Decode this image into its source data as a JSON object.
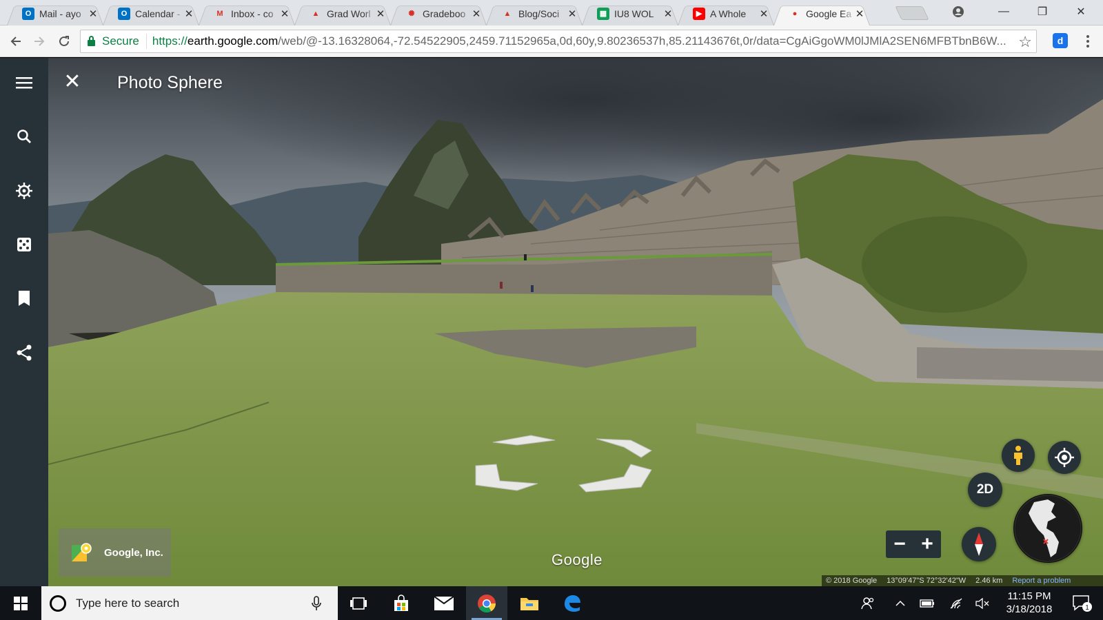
{
  "browser": {
    "tabs": [
      {
        "title": "Mail - ayo",
        "favicon_text": "O",
        "favicon_color": "#0072c6"
      },
      {
        "title": "Calendar -",
        "favicon_text": "O",
        "favicon_color": "#0072c6"
      },
      {
        "title": "Inbox - co",
        "favicon_text": "M",
        "favicon_color": "#ffffff"
      },
      {
        "title": "Grad Worl",
        "favicon_text": "▲",
        "favicon_color": "#ffffff"
      },
      {
        "title": "Gradeboo",
        "favicon_text": "✺",
        "favicon_color": "#ffffff"
      },
      {
        "title": "Blog/Soci",
        "favicon_text": "▲",
        "favicon_color": "#ffffff"
      },
      {
        "title": "IU8 WOL",
        "favicon_text": "▦",
        "favicon_color": "#0f9d58"
      },
      {
        "title": "A Whole",
        "favicon_text": "▶",
        "favicon_color": "#ff0000"
      },
      {
        "title": "Google Ea",
        "favicon_text": "●",
        "favicon_color": "#ffffff"
      }
    ],
    "active_tab": 8,
    "tab_close": "✕",
    "secure_label": "Secure",
    "url_scheme": "https://",
    "url_host": "earth.google.com",
    "url_rest": "/web/@-13.16328064,-72.54522905,2459.71152965a,0d,60y,9.80236537h,85.21143676t,0r/data=CgAiGgoWM0lJMlA2SEN6MFBTbnB6W...",
    "extension_label": "d"
  },
  "earth": {
    "photo_sphere_title": "Photo Sphere",
    "close_glyph": "✕",
    "attribution": "Google, Inc.",
    "watermark": "Google",
    "view_mode": "2D",
    "zoom_out": "−",
    "zoom_in": "+",
    "copyright": "© 2018 Google",
    "coordinates": "13°09'47\"S 72°32'42\"W",
    "scale": "2.46 km",
    "report": "Report a problem"
  },
  "taskbar": {
    "search_placeholder": "Type here to search",
    "time": "11:15 PM",
    "date": "3/18/2018",
    "notification_count": "1"
  },
  "colors": {
    "sidebar": "#263238",
    "accent": "#1a73e8",
    "secure_green": "#0b8043"
  }
}
